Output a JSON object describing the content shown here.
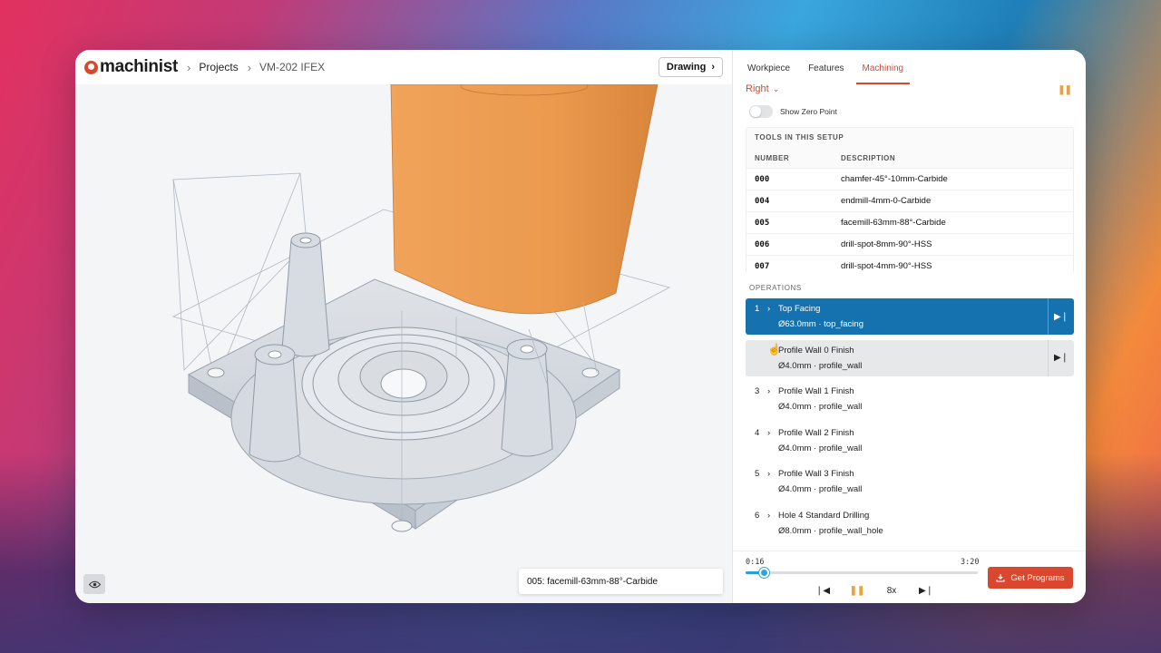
{
  "app": {
    "brand": "machinist",
    "accent": "#d9472f"
  },
  "breadcrumb": {
    "projects": "Projects",
    "part": "VM-202 IFEX"
  },
  "toolbar": {
    "drawing_label": "Drawing"
  },
  "viewport": {
    "active_tool_label": "005: facemill-63mm-88°-Carbide",
    "eye_icon": "eye-icon"
  },
  "tabs": [
    {
      "label": "Workpiece",
      "active": false
    },
    {
      "label": "Features",
      "active": false
    },
    {
      "label": "Machining",
      "active": true
    }
  ],
  "view": {
    "selected": "Right"
  },
  "zero_point": {
    "label": "Show Zero Point",
    "on": false
  },
  "tools": {
    "title": "TOOLS IN THIS SETUP",
    "columns": [
      "NUMBER",
      "DESCRIPTION"
    ],
    "rows": [
      {
        "number": "000",
        "description": "chamfer-45°-10mm-Carbide"
      },
      {
        "number": "004",
        "description": "endmill-4mm-0-Carbide"
      },
      {
        "number": "005",
        "description": "facemill-63mm-88°-Carbide"
      },
      {
        "number": "006",
        "description": "drill-spot-8mm-90°-HSS"
      },
      {
        "number": "007",
        "description": "drill-spot-4mm-90°-HSS"
      }
    ]
  },
  "operations": {
    "title": "OPERATIONS",
    "items": [
      {
        "num": "1",
        "name": "Top Facing",
        "detail": "Ø63.0mm · top_facing",
        "state": "active"
      },
      {
        "num": "",
        "name": "Profile Wall 0 Finish",
        "detail": "Ø4.0mm · profile_wall",
        "state": "hover"
      },
      {
        "num": "3",
        "name": "Profile Wall 1 Finish",
        "detail": "Ø4.0mm · profile_wall",
        "state": "normal"
      },
      {
        "num": "4",
        "name": "Profile Wall 2 Finish",
        "detail": "Ø4.0mm · profile_wall",
        "state": "normal"
      },
      {
        "num": "5",
        "name": "Profile Wall 3 Finish",
        "detail": "Ø4.0mm · profile_wall",
        "state": "normal"
      },
      {
        "num": "6",
        "name": "Hole 4 Standard Drilling",
        "detail": "Ø8.0mm · profile_wall_hole",
        "state": "normal"
      }
    ]
  },
  "playback": {
    "current": "0:16",
    "total": "3:20",
    "progress": 0.08,
    "speed": "8x",
    "get_programs_label": "Get Programs"
  }
}
